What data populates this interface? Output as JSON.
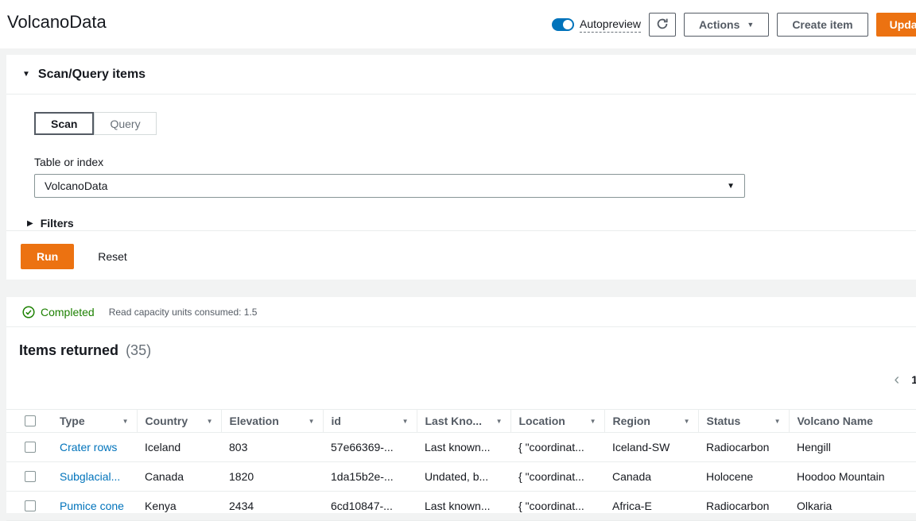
{
  "header": {
    "title": "VolcanoData",
    "autopreview": {
      "label": "Autopreview",
      "state": "on"
    },
    "actions_button": "Actions",
    "create_item_button": "Create item",
    "update_button": "Update"
  },
  "scan_panel": {
    "title": "Scan/Query items",
    "mode_tabs": [
      {
        "label": "Scan",
        "selected": true
      },
      {
        "label": "Query",
        "selected": false
      }
    ],
    "table_or_index": {
      "label": "Table or index",
      "selected_value": "VolcanoData"
    },
    "filters_label": "Filters",
    "run_button": "Run",
    "reset_button": "Reset"
  },
  "result_status": {
    "state": "Completed",
    "detail": "Read capacity units consumed: 1.5"
  },
  "results": {
    "title": "Items returned",
    "count": "(35)",
    "pagination": {
      "current_page": "1"
    }
  },
  "table": {
    "columns": [
      {
        "label": "Type",
        "sortable": true
      },
      {
        "label": "Country",
        "sortable": true
      },
      {
        "label": "Elevation",
        "sortable": true
      },
      {
        "label": "id",
        "sortable": true
      },
      {
        "label": "Last Kno...",
        "sortable": true
      },
      {
        "label": "Location",
        "sortable": true
      },
      {
        "label": "Region",
        "sortable": true
      },
      {
        "label": "Status",
        "sortable": true
      },
      {
        "label": "Volcano Name",
        "sortable": false
      }
    ],
    "rows": [
      [
        "Crater rows",
        "Iceland",
        "803",
        "57e66369-...",
        "Last known...",
        "{ \"coordinat...",
        "Iceland-SW",
        "Radiocarbon",
        "Hengill"
      ],
      [
        "Subglacial...",
        "Canada",
        "1820",
        "1da15b2e-...",
        "Undated, b...",
        "{ \"coordinat...",
        "Canada",
        "Holocene",
        "Hoodoo Mountain"
      ],
      [
        "Pumice cone",
        "Kenya",
        "2434",
        "6cd10847-...",
        "Last known...",
        "{ \"coordinat...",
        "Africa-E",
        "Radiocarbon",
        "Olkaria"
      ]
    ]
  },
  "icons": {
    "caret_down": "▼",
    "caret_right": "▶",
    "prev_chevron": "‹",
    "sort_caret": "▼"
  },
  "colors": {
    "accent_orange": "#ec7211",
    "link_blue": "#0073bb",
    "success_green": "#1d8102",
    "toggle_blue": "#0073bb"
  }
}
